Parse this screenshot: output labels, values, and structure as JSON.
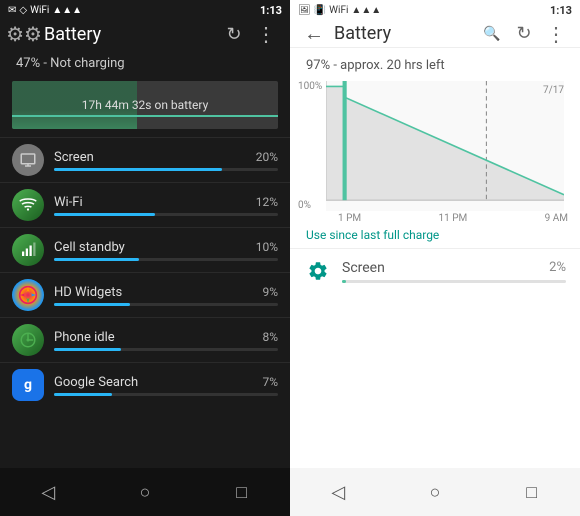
{
  "left": {
    "statusBar": {
      "time": "1:13",
      "icons": [
        "msg-icon",
        "diamond-icon",
        "wifi-icon",
        "signal-icon"
      ]
    },
    "header": {
      "title": "Battery",
      "refreshLabel": "↻",
      "moreLabel": "⋮"
    },
    "batteryStatus": "47% - Not charging",
    "batteryBarText": "17h 44m 32s on battery",
    "usageItems": [
      {
        "name": "Screen",
        "pct": "20%",
        "barWidth": "75",
        "iconType": "screen"
      },
      {
        "name": "Wi-Fi",
        "pct": "12%",
        "barWidth": "45",
        "iconType": "wifi"
      },
      {
        "name": "Cell standby",
        "pct": "10%",
        "barWidth": "38",
        "iconType": "cell"
      },
      {
        "name": "HD Widgets",
        "pct": "9%",
        "barWidth": "34",
        "iconType": "widgets"
      },
      {
        "name": "Phone idle",
        "pct": "8%",
        "barWidth": "30",
        "iconType": "phone"
      },
      {
        "name": "Google Search",
        "pct": "7%",
        "barWidth": "26",
        "iconType": "google"
      }
    ],
    "nav": {
      "back": "◁",
      "home": "○",
      "recents": "□"
    }
  },
  "right": {
    "statusBar": {
      "time": "1:13",
      "icons": [
        "photo-icon",
        "vibrate-icon",
        "wifi-icon",
        "signal-icon"
      ]
    },
    "header": {
      "backLabel": "←",
      "title": "Battery",
      "searchLabel": "🔍",
      "refreshLabel": "↻",
      "moreLabel": "⋮"
    },
    "batteryStatus": "97% - approx. 20 hrs left",
    "chart": {
      "yLabels": [
        "100%",
        "0%"
      ],
      "xLabels": [
        "1 PM",
        "11 PM",
        "9 AM"
      ],
      "datelabel": "7/17"
    },
    "useSinceCharge": "Use since last full charge",
    "usageItems": [
      {
        "name": "Screen",
        "pct": "2%",
        "barWidth": "4",
        "iconType": "gear"
      }
    ],
    "nav": {
      "back": "◁",
      "home": "○",
      "recents": "□"
    }
  }
}
